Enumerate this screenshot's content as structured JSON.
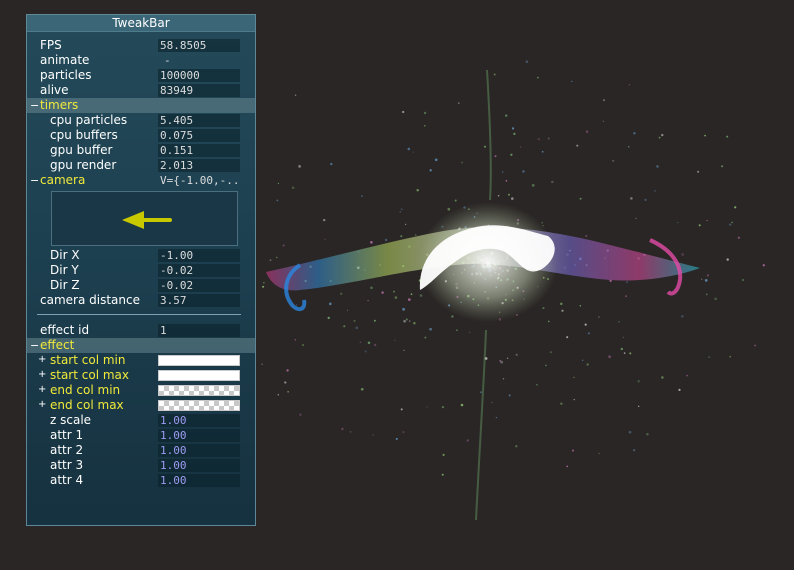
{
  "window": {
    "title": "TweakBar"
  },
  "stats": [
    {
      "label": "FPS",
      "value": "58.8505"
    },
    {
      "label": "animate",
      "value": "-"
    },
    {
      "label": "particles",
      "value": "100000"
    },
    {
      "label": "alive",
      "value": "83949"
    }
  ],
  "timers": {
    "label": "timers",
    "toggle": "−",
    "items": [
      {
        "label": "cpu particles",
        "value": "5.405"
      },
      {
        "label": "cpu buffers",
        "value": "0.075"
      },
      {
        "label": "gpu buffer",
        "value": "0.151"
      },
      {
        "label": "gpu render",
        "value": "2.013"
      }
    ]
  },
  "camera": {
    "label": "camera",
    "toggle": "−",
    "value": "V={-1.00,-..",
    "dirs": [
      {
        "label": "Dir X",
        "value": "-1.00"
      },
      {
        "label": "Dir Y",
        "value": "-0.02"
      },
      {
        "label": "Dir Z",
        "value": "-0.02"
      }
    ],
    "distance_label": "camera distance",
    "distance_value": "3.57"
  },
  "effect_id": {
    "label": "effect id",
    "value": "1"
  },
  "effect": {
    "label": "effect",
    "toggle": "−",
    "colors": [
      {
        "label": "start col min",
        "expand": "+"
      },
      {
        "label": "start col max",
        "expand": "+"
      },
      {
        "label": "end col min",
        "expand": "+"
      },
      {
        "label": "end col max",
        "expand": "+"
      }
    ],
    "params": [
      {
        "label": "z scale",
        "value": "1.00"
      },
      {
        "label": "attr 1",
        "value": "1.00"
      },
      {
        "label": "attr 2",
        "value": "1.00"
      },
      {
        "label": "attr 3",
        "value": "1.00"
      },
      {
        "label": "attr 4",
        "value": "1.00"
      }
    ]
  },
  "colors": {
    "background": "#2a2625",
    "panel": "#1d4050",
    "group_label": "#f0ea3a",
    "numeric_value": "#9e9cf2",
    "arrow": "#c8c800"
  },
  "icons": {
    "direction_arrow": "arrow-left-icon",
    "collapse": "collapse-icon",
    "expand": "expand-icon"
  }
}
